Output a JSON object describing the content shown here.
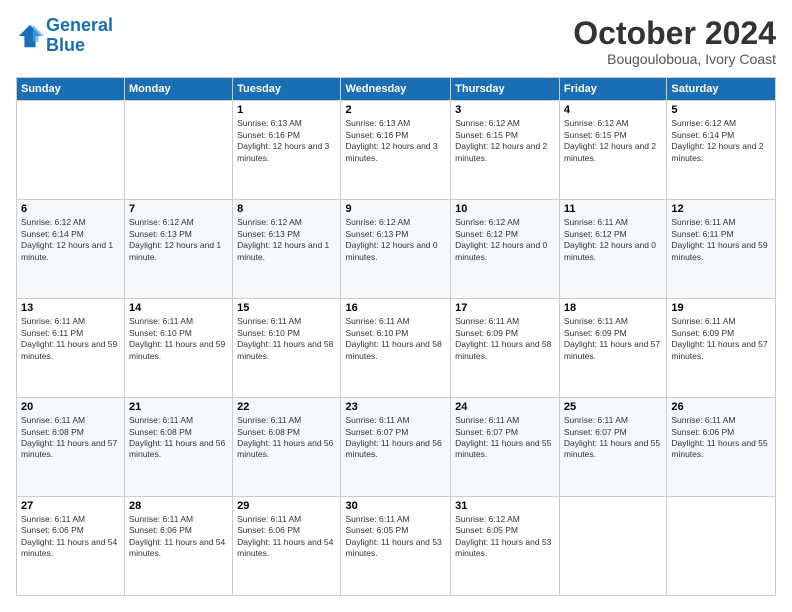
{
  "header": {
    "logo_line1": "General",
    "logo_line2": "Blue",
    "month_title": "October 2024",
    "location": "Bougouloboua, Ivory Coast"
  },
  "days_of_week": [
    "Sunday",
    "Monday",
    "Tuesday",
    "Wednesday",
    "Thursday",
    "Friday",
    "Saturday"
  ],
  "weeks": [
    [
      {
        "day": "",
        "info": ""
      },
      {
        "day": "",
        "info": ""
      },
      {
        "day": "1",
        "info": "Sunrise: 6:13 AM\nSunset: 6:16 PM\nDaylight: 12 hours and 3 minutes."
      },
      {
        "day": "2",
        "info": "Sunrise: 6:13 AM\nSunset: 6:16 PM\nDaylight: 12 hours and 3 minutes."
      },
      {
        "day": "3",
        "info": "Sunrise: 6:12 AM\nSunset: 6:15 PM\nDaylight: 12 hours and 2 minutes."
      },
      {
        "day": "4",
        "info": "Sunrise: 6:12 AM\nSunset: 6:15 PM\nDaylight: 12 hours and 2 minutes."
      },
      {
        "day": "5",
        "info": "Sunrise: 6:12 AM\nSunset: 6:14 PM\nDaylight: 12 hours and 2 minutes."
      }
    ],
    [
      {
        "day": "6",
        "info": "Sunrise: 6:12 AM\nSunset: 6:14 PM\nDaylight: 12 hours and 1 minute."
      },
      {
        "day": "7",
        "info": "Sunrise: 6:12 AM\nSunset: 6:13 PM\nDaylight: 12 hours and 1 minute."
      },
      {
        "day": "8",
        "info": "Sunrise: 6:12 AM\nSunset: 6:13 PM\nDaylight: 12 hours and 1 minute."
      },
      {
        "day": "9",
        "info": "Sunrise: 6:12 AM\nSunset: 6:13 PM\nDaylight: 12 hours and 0 minutes."
      },
      {
        "day": "10",
        "info": "Sunrise: 6:12 AM\nSunset: 6:12 PM\nDaylight: 12 hours and 0 minutes."
      },
      {
        "day": "11",
        "info": "Sunrise: 6:11 AM\nSunset: 6:12 PM\nDaylight: 12 hours and 0 minutes."
      },
      {
        "day": "12",
        "info": "Sunrise: 6:11 AM\nSunset: 6:11 PM\nDaylight: 11 hours and 59 minutes."
      }
    ],
    [
      {
        "day": "13",
        "info": "Sunrise: 6:11 AM\nSunset: 6:11 PM\nDaylight: 11 hours and 59 minutes."
      },
      {
        "day": "14",
        "info": "Sunrise: 6:11 AM\nSunset: 6:10 PM\nDaylight: 11 hours and 59 minutes."
      },
      {
        "day": "15",
        "info": "Sunrise: 6:11 AM\nSunset: 6:10 PM\nDaylight: 11 hours and 58 minutes."
      },
      {
        "day": "16",
        "info": "Sunrise: 6:11 AM\nSunset: 6:10 PM\nDaylight: 11 hours and 58 minutes."
      },
      {
        "day": "17",
        "info": "Sunrise: 6:11 AM\nSunset: 6:09 PM\nDaylight: 11 hours and 58 minutes."
      },
      {
        "day": "18",
        "info": "Sunrise: 6:11 AM\nSunset: 6:09 PM\nDaylight: 11 hours and 57 minutes."
      },
      {
        "day": "19",
        "info": "Sunrise: 6:11 AM\nSunset: 6:09 PM\nDaylight: 11 hours and 57 minutes."
      }
    ],
    [
      {
        "day": "20",
        "info": "Sunrise: 6:11 AM\nSunset: 6:08 PM\nDaylight: 11 hours and 57 minutes."
      },
      {
        "day": "21",
        "info": "Sunrise: 6:11 AM\nSunset: 6:08 PM\nDaylight: 11 hours and 56 minutes."
      },
      {
        "day": "22",
        "info": "Sunrise: 6:11 AM\nSunset: 6:08 PM\nDaylight: 11 hours and 56 minutes."
      },
      {
        "day": "23",
        "info": "Sunrise: 6:11 AM\nSunset: 6:07 PM\nDaylight: 11 hours and 56 minutes."
      },
      {
        "day": "24",
        "info": "Sunrise: 6:11 AM\nSunset: 6:07 PM\nDaylight: 11 hours and 55 minutes."
      },
      {
        "day": "25",
        "info": "Sunrise: 6:11 AM\nSunset: 6:07 PM\nDaylight: 11 hours and 55 minutes."
      },
      {
        "day": "26",
        "info": "Sunrise: 6:11 AM\nSunset: 6:06 PM\nDaylight: 11 hours and 55 minutes."
      }
    ],
    [
      {
        "day": "27",
        "info": "Sunrise: 6:11 AM\nSunset: 6:06 PM\nDaylight: 11 hours and 54 minutes."
      },
      {
        "day": "28",
        "info": "Sunrise: 6:11 AM\nSunset: 6:06 PM\nDaylight: 11 hours and 54 minutes."
      },
      {
        "day": "29",
        "info": "Sunrise: 6:11 AM\nSunset: 6:06 PM\nDaylight: 11 hours and 54 minutes."
      },
      {
        "day": "30",
        "info": "Sunrise: 6:11 AM\nSunset: 6:05 PM\nDaylight: 11 hours and 53 minutes."
      },
      {
        "day": "31",
        "info": "Sunrise: 6:12 AM\nSunset: 6:05 PM\nDaylight: 11 hours and 53 minutes."
      },
      {
        "day": "",
        "info": ""
      },
      {
        "day": "",
        "info": ""
      }
    ]
  ]
}
